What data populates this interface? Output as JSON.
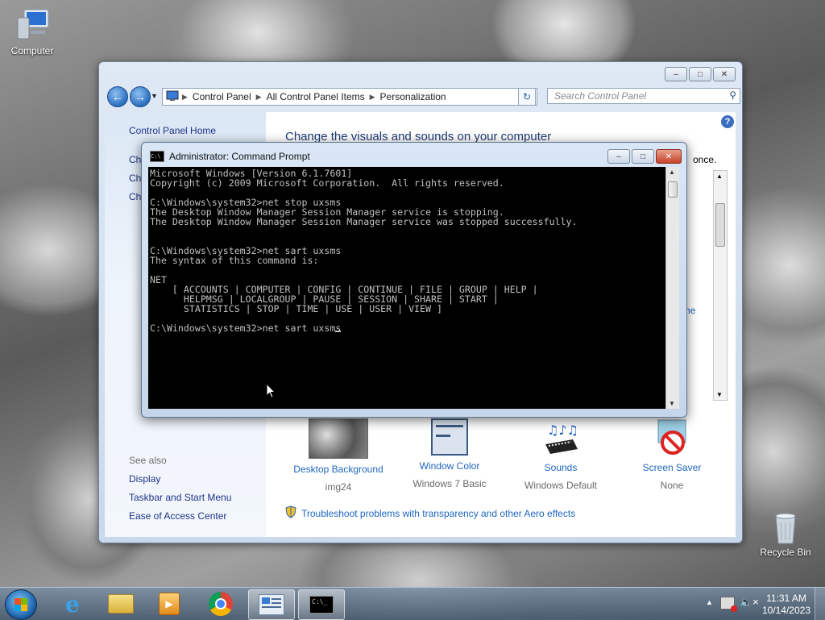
{
  "desktop": {
    "icons": [
      {
        "label": "Computer"
      },
      {
        "label": "Recycle Bin"
      }
    ]
  },
  "control_panel": {
    "breadcrumb": [
      "Control Panel",
      "All Control Panel Items",
      "Personalization"
    ],
    "search_placeholder": "Search Control Panel",
    "left_links": {
      "home": "Control Panel Home",
      "partial": [
        "Ch",
        "Ch",
        "Ch"
      ],
      "see_also": "See also",
      "display": "Display",
      "taskbar": "Taskbar and Start Menu",
      "ease": "Ease of Access Center"
    },
    "heading": "Change the visuals and sounds on your computer",
    "peek_once": "once.",
    "peek_ne": "ne",
    "bottom": [
      {
        "label": "Desktop Background",
        "sub": "img24"
      },
      {
        "label": "Window Color",
        "sub": "Windows 7 Basic"
      },
      {
        "label": "Sounds",
        "sub": "Windows Default"
      },
      {
        "label": "Screen Saver",
        "sub": "None"
      }
    ],
    "troubleshoot": "Troubleshoot problems with transparency and other Aero effects"
  },
  "cmd": {
    "title": "Administrator: Command Prompt",
    "lines": [
      "Microsoft Windows [Version 6.1.7601]",
      "Copyright (c) 2009 Microsoft Corporation.  All rights reserved.",
      "",
      "C:\\Windows\\system32>net stop uxsms",
      "The Desktop Window Manager Session Manager service is stopping.",
      "The Desktop Window Manager Session Manager service was stopped successfully.",
      "",
      "",
      "C:\\Windows\\system32>net sart uxsms",
      "The syntax of this command is:",
      "",
      "NET",
      "    [ ACCOUNTS | COMPUTER | CONFIG | CONTINUE | FILE | GROUP | HELP |",
      "      HELPMSG | LOCALGROUP | PAUSE | SESSION | SHARE | START |",
      "      STATISTICS | STOP | TIME | USE | USER | VIEW ]",
      "",
      "C:\\Windows\\system32>net sart uxsms"
    ]
  },
  "taskbar": {
    "clock_time": "11:31 AM",
    "clock_date": "10/14/2023",
    "pinned": [
      "internet-explorer",
      "windows-explorer",
      "media-player",
      "chrome",
      "control-panel",
      "command-prompt"
    ]
  }
}
